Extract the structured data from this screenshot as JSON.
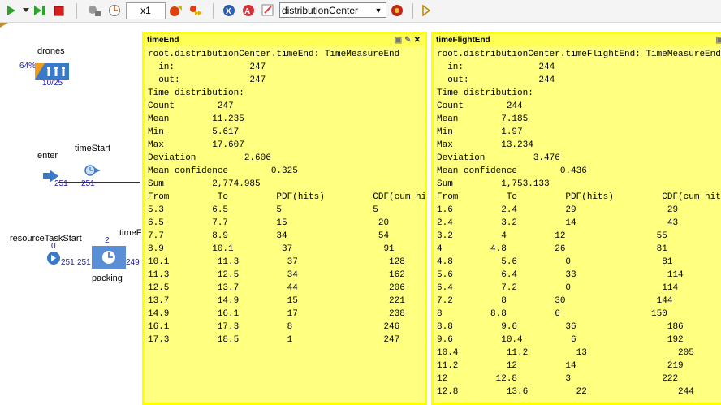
{
  "toolbar": {
    "speed": "x1",
    "combo": "distributionCenter"
  },
  "canvas": {
    "drones": {
      "label": "drones",
      "percent": "64%",
      "ratio": "10/25"
    },
    "enter": {
      "label": "enter",
      "count": "251"
    },
    "timeStart": {
      "label": "timeStart",
      "count": "251"
    },
    "resourceTaskStart": {
      "label": "resourceTaskStart",
      "count": "0",
      "out": "251"
    },
    "packing": {
      "label": "packing",
      "queue": "2",
      "in": "251",
      "out": "249"
    },
    "timeFl_label": "timeFl"
  },
  "timeEnd": {
    "title": "timeEnd",
    "lines": [
      "root.distributionCenter.timeEnd: TimeMeasureEnd",
      "  in:              247",
      "  out:             247",
      "Time distribution:",
      "Count        247",
      "Mean        11.235",
      "Min         5.617",
      "Max         17.607",
      "Deviation         2.606",
      "Mean confidence        0.325",
      "Sum         2,774.985",
      "From         To         PDF(hits)         CDF(cum hits)",
      "5.3         6.5         5                 5",
      "6.5         7.7         15                 20",
      "7.7         8.9         34                 54",
      "8.9         10.1         37                 91",
      "10.1         11.3         37                 128",
      "11.3         12.5         34                 162",
      "12.5         13.7         44                 206",
      "13.7         14.9         15                 221",
      "14.9         16.1         17                 238",
      "16.1         17.3         8                 246",
      "17.3         18.5         1                 247"
    ]
  },
  "timeFlightEnd": {
    "title": "timeFlightEnd",
    "lines": [
      "root.distributionCenter.timeFlightEnd: TimeMeasureEnd",
      "  in:              244",
      "  out:             244",
      "Time distribution:",
      "Count        244",
      "Mean        7.185",
      "Min         1.97",
      "Max         13.234",
      "Deviation         3.476",
      "Mean confidence        0.436",
      "Sum         1,753.133",
      "From         To         PDF(hits)         CDF(cum hits)",
      "1.6         2.4         29                 29",
      "2.4         3.2         14                 43",
      "3.2         4         12                 55",
      "4         4.8         26                 81",
      "4.8         5.6         0                 81",
      "5.6         6.4         33                 114",
      "6.4         7.2         0                 114",
      "7.2         8         30                 144",
      "8         8.8         6                 150",
      "8.8         9.6         36                 186",
      "9.6         10.4         6                 192",
      "10.4         11.2         13                 205",
      "11.2         12         14                 219",
      "12         12.8         3                 222",
      "12.8         13.6         22                 244"
    ]
  }
}
